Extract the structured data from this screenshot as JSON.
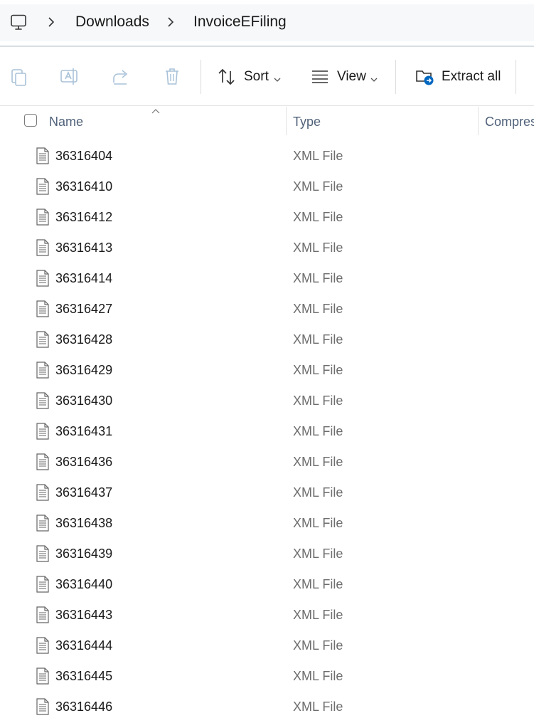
{
  "breadcrumb": {
    "items": [
      "Downloads",
      "InvoiceEFiling"
    ]
  },
  "toolbar": {
    "sort_label": "Sort",
    "view_label": "View",
    "extract_label": "Extract all"
  },
  "columns": {
    "name": "Name",
    "type": "Type",
    "compressed": "Compres"
  },
  "files": [
    {
      "name": "36316404",
      "type": "XML File"
    },
    {
      "name": "36316410",
      "type": "XML File"
    },
    {
      "name": "36316412",
      "type": "XML File"
    },
    {
      "name": "36316413",
      "type": "XML File"
    },
    {
      "name": "36316414",
      "type": "XML File"
    },
    {
      "name": "36316427",
      "type": "XML File"
    },
    {
      "name": "36316428",
      "type": "XML File"
    },
    {
      "name": "36316429",
      "type": "XML File"
    },
    {
      "name": "36316430",
      "type": "XML File"
    },
    {
      "name": "36316431",
      "type": "XML File"
    },
    {
      "name": "36316436",
      "type": "XML File"
    },
    {
      "name": "36316437",
      "type": "XML File"
    },
    {
      "name": "36316438",
      "type": "XML File"
    },
    {
      "name": "36316439",
      "type": "XML File"
    },
    {
      "name": "36316440",
      "type": "XML File"
    },
    {
      "name": "36316443",
      "type": "XML File"
    },
    {
      "name": "36316444",
      "type": "XML File"
    },
    {
      "name": "36316445",
      "type": "XML File"
    },
    {
      "name": "36316446",
      "type": "XML File"
    }
  ],
  "colors": {
    "accent": "#0067c0",
    "header_text": "#50627a",
    "type_text": "#6d6d6d"
  }
}
